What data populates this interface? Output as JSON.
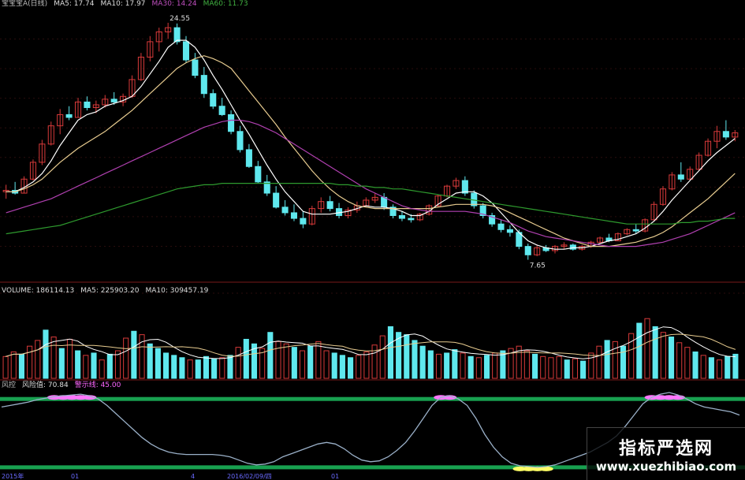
{
  "header": {
    "ma_line": [
      {
        "text": "宝宝宝A(日线)",
        "color": "#bbbbbb"
      },
      {
        "text": "MA5: 17.74",
        "color": "#dddddd"
      },
      {
        "text": "MA10: 17.97",
        "color": "#dddddd"
      },
      {
        "text": "MA30: 14.24",
        "color": "#c050c0"
      },
      {
        "text": "MA60: 11.73",
        "color": "#40b040"
      }
    ]
  },
  "colors": {
    "up": "#d83a3a",
    "down": "#5fe8ee",
    "ma5": "#ffffff",
    "ma10": "#e8cc90",
    "ma30": "#b040b0",
    "ma60": "#2e9a2e",
    "divider": "#7a1a1a",
    "risk": "#9ab0c8",
    "band": "#18a050",
    "high": "#ff77ff",
    "low": "#ffff66"
  },
  "chart_data": [
    {
      "type": "candlestick",
      "title": "宝宝宝A(日线)",
      "price_annotations": [
        {
          "label": "24.55",
          "value": 24.55
        },
        {
          "label": "7.65",
          "value": 7.65
        }
      ],
      "ylim": [
        6.5,
        25.5
      ],
      "ohlc": [
        [
          12.5,
          13.0,
          12.0,
          12.6
        ],
        [
          12.6,
          13.2,
          12.3,
          12.4
        ],
        [
          12.4,
          13.6,
          12.4,
          13.4
        ],
        [
          13.4,
          14.8,
          13.3,
          14.6
        ],
        [
          14.6,
          16.2,
          14.4,
          15.9
        ],
        [
          15.9,
          17.5,
          15.8,
          17.2
        ],
        [
          17.2,
          18.4,
          16.6,
          18.0
        ],
        [
          18.0,
          18.6,
          17.6,
          17.8
        ],
        [
          17.8,
          19.2,
          17.8,
          18.9
        ],
        [
          18.9,
          19.3,
          18.3,
          18.5
        ],
        [
          18.5,
          19.0,
          18.1,
          18.7
        ],
        [
          18.7,
          19.4,
          18.5,
          19.1
        ],
        [
          19.1,
          19.6,
          18.7,
          18.9
        ],
        [
          18.9,
          19.5,
          18.6,
          19.3
        ],
        [
          19.3,
          20.8,
          19.2,
          20.5
        ],
        [
          20.5,
          22.4,
          20.4,
          22.1
        ],
        [
          22.1,
          23.6,
          21.8,
          23.2
        ],
        [
          23.2,
          24.2,
          22.5,
          23.9
        ],
        [
          23.9,
          24.55,
          23.4,
          24.2
        ],
        [
          24.2,
          24.5,
          23.0,
          23.2
        ],
        [
          23.2,
          23.6,
          21.7,
          21.9
        ],
        [
          21.9,
          22.4,
          20.6,
          20.8
        ],
        [
          20.8,
          21.4,
          19.2,
          19.5
        ],
        [
          19.5,
          19.8,
          18.4,
          18.6
        ],
        [
          18.6,
          19.2,
          17.9,
          18.0
        ],
        [
          18.0,
          18.3,
          16.6,
          16.8
        ],
        [
          16.8,
          17.2,
          15.3,
          15.5
        ],
        [
          15.5,
          15.9,
          14.2,
          14.3
        ],
        [
          14.3,
          14.7,
          13.1,
          13.2
        ],
        [
          13.2,
          13.7,
          12.2,
          12.4
        ],
        [
          12.4,
          12.9,
          11.3,
          11.4
        ],
        [
          11.4,
          11.9,
          10.8,
          11.0
        ],
        [
          11.0,
          11.6,
          10.4,
          10.6
        ],
        [
          10.6,
          11.1,
          9.9,
          10.2
        ],
        [
          10.2,
          11.5,
          10.1,
          11.3
        ],
        [
          11.3,
          12.1,
          11.0,
          11.8
        ],
        [
          11.8,
          12.2,
          11.1,
          11.3
        ],
        [
          11.3,
          11.7,
          10.6,
          10.8
        ],
        [
          10.8,
          11.4,
          10.6,
          11.2
        ],
        [
          11.2,
          11.8,
          11.0,
          11.5
        ],
        [
          11.5,
          12.1,
          11.4,
          11.9
        ],
        [
          11.9,
          12.4,
          11.7,
          12.1
        ],
        [
          12.1,
          12.4,
          11.2,
          11.4
        ],
        [
          11.4,
          11.6,
          10.6,
          10.8
        ],
        [
          10.8,
          11.1,
          10.4,
          10.6
        ],
        [
          10.6,
          10.9,
          10.3,
          10.5
        ],
        [
          10.5,
          11.0,
          10.4,
          10.9
        ],
        [
          10.9,
          11.6,
          10.8,
          11.5
        ],
        [
          11.5,
          12.3,
          11.4,
          12.2
        ],
        [
          12.2,
          13.0,
          12.1,
          12.9
        ],
        [
          12.9,
          13.5,
          12.7,
          13.3
        ],
        [
          13.3,
          13.6,
          12.2,
          12.4
        ],
        [
          12.4,
          12.6,
          11.3,
          11.5
        ],
        [
          11.5,
          11.7,
          10.6,
          10.8
        ],
        [
          10.8,
          11.0,
          10.0,
          10.2
        ],
        [
          10.2,
          10.5,
          9.6,
          9.8
        ],
        [
          9.8,
          10.1,
          9.3,
          9.6
        ],
        [
          9.6,
          9.8,
          8.4,
          8.6
        ],
        [
          8.6,
          8.8,
          7.65,
          8.0
        ],
        [
          8.0,
          8.7,
          7.9,
          8.5
        ],
        [
          8.5,
          8.7,
          8.2,
          8.3
        ],
        [
          8.3,
          8.7,
          8.1,
          8.6
        ],
        [
          8.6,
          8.9,
          8.4,
          8.7
        ],
        [
          8.7,
          8.8,
          8.3,
          8.4
        ],
        [
          8.4,
          8.7,
          8.3,
          8.6
        ],
        [
          8.6,
          9.0,
          8.5,
          8.9
        ],
        [
          8.9,
          9.3,
          8.8,
          9.2
        ],
        [
          9.2,
          9.5,
          8.9,
          9.0
        ],
        [
          9.0,
          9.6,
          9.0,
          9.5
        ],
        [
          9.5,
          9.9,
          9.4,
          9.8
        ],
        [
          9.8,
          10.2,
          9.5,
          9.7
        ],
        [
          9.7,
          10.6,
          9.6,
          10.5
        ],
        [
          10.5,
          11.8,
          10.4,
          11.6
        ],
        [
          11.6,
          12.9,
          11.5,
          12.7
        ],
        [
          12.7,
          13.9,
          12.6,
          13.7
        ],
        [
          13.7,
          14.6,
          13.2,
          13.4
        ],
        [
          13.4,
          14.3,
          13.3,
          14.1
        ],
        [
          14.1,
          15.3,
          14.0,
          15.1
        ],
        [
          15.1,
          16.3,
          15.0,
          16.1
        ],
        [
          16.1,
          17.2,
          15.6,
          16.8
        ],
        [
          16.8,
          17.6,
          16.2,
          16.4
        ],
        [
          16.4,
          16.9,
          16.1,
          16.7
        ]
      ],
      "ma_series": [
        {
          "name": "MA5",
          "values": [
            12.5,
            12.5,
            12.8,
            13.2,
            13.8,
            14.7,
            15.8,
            16.7,
            17.6,
            18.0,
            18.2,
            18.6,
            18.8,
            19.0,
            19.3,
            20.0,
            20.9,
            21.8,
            22.8,
            23.3,
            23.3,
            22.8,
            21.9,
            20.8,
            19.8,
            18.7,
            17.6,
            16.6,
            15.5,
            14.4,
            13.4,
            12.5,
            11.8,
            11.1,
            10.9,
            10.9,
            10.9,
            11.0,
            11.1,
            11.3,
            11.5,
            11.4,
            11.4,
            11.3,
            11.1,
            10.8,
            10.8,
            11.1,
            11.6,
            12.0,
            12.4,
            12.5,
            12.5,
            12.2,
            11.7,
            11.0,
            10.3,
            9.6,
            9.0,
            8.7,
            8.5,
            8.4,
            8.4,
            8.5,
            8.5,
            8.6,
            8.8,
            9.0,
            9.1,
            9.3,
            9.5,
            9.9,
            10.4,
            11.1,
            11.9,
            12.6,
            13.3,
            14.0,
            14.7,
            15.3,
            15.8,
            16.3
          ],
          "color": "#ffffff"
        },
        {
          "name": "MA10",
          "values": [
            12.5,
            12.5,
            12.7,
            13.0,
            13.4,
            14.0,
            14.6,
            15.1,
            15.6,
            16.0,
            16.4,
            16.8,
            17.3,
            17.8,
            18.3,
            18.9,
            19.5,
            20.1,
            20.7,
            21.3,
            21.7,
            22.0,
            22.2,
            22.0,
            21.7,
            21.3,
            20.5,
            19.7,
            18.9,
            18.1,
            17.3,
            16.4,
            15.6,
            14.8,
            14.0,
            13.3,
            12.7,
            12.2,
            11.8,
            11.5,
            11.4,
            11.3,
            11.3,
            11.3,
            11.3,
            11.3,
            11.3,
            11.3,
            11.4,
            11.5,
            11.6,
            11.6,
            11.6,
            11.6,
            11.5,
            11.3,
            11.0,
            10.7,
            10.4,
            10.1,
            9.8,
            9.5,
            9.2,
            9.0,
            8.8,
            8.6,
            8.6,
            8.6,
            8.7,
            8.8,
            8.9,
            9.1,
            9.3,
            9.6,
            10.0,
            10.5,
            11.0,
            11.5,
            12.0,
            12.6,
            13.2,
            13.8
          ],
          "color": "#e8cc90"
        },
        {
          "name": "MA30",
          "values": [
            11.0,
            11.2,
            11.4,
            11.6,
            11.8,
            12.0,
            12.3,
            12.6,
            12.9,
            13.2,
            13.5,
            13.8,
            14.1,
            14.4,
            14.7,
            15.0,
            15.3,
            15.6,
            15.9,
            16.2,
            16.5,
            16.8,
            17.1,
            17.3,
            17.5,
            17.6,
            17.6,
            17.5,
            17.3,
            17.0,
            16.7,
            16.3,
            15.9,
            15.5,
            15.1,
            14.7,
            14.3,
            13.9,
            13.5,
            13.1,
            12.7,
            12.4,
            12.1,
            11.8,
            11.5,
            11.3,
            11.2,
            11.1,
            11.1,
            11.1,
            11.1,
            11.1,
            11.0,
            10.9,
            10.7,
            10.5,
            10.3,
            10.0,
            9.7,
            9.5,
            9.3,
            9.2,
            9.1,
            9.0,
            8.9,
            8.8,
            8.7,
            8.6,
            8.6,
            8.6,
            8.6,
            8.7,
            8.8,
            8.9,
            9.1,
            9.3,
            9.5,
            9.8,
            10.1,
            10.4,
            10.7,
            11.0
          ],
          "color": "#b040b0"
        },
        {
          "name": "MA60",
          "values": [
            9.5,
            9.6,
            9.7,
            9.8,
            9.9,
            10.0,
            10.1,
            10.3,
            10.5,
            10.7,
            10.9,
            11.1,
            11.3,
            11.5,
            11.7,
            11.9,
            12.1,
            12.3,
            12.5,
            12.7,
            12.8,
            12.9,
            13.0,
            13.0,
            13.1,
            13.1,
            13.1,
            13.1,
            13.1,
            13.1,
            13.1,
            13.1,
            13.1,
            13.1,
            13.1,
            13.1,
            13.1,
            13.0,
            13.0,
            12.9,
            12.9,
            12.8,
            12.8,
            12.7,
            12.7,
            12.6,
            12.5,
            12.4,
            12.3,
            12.2,
            12.1,
            12.0,
            11.9,
            11.8,
            11.7,
            11.6,
            11.5,
            11.4,
            11.3,
            11.2,
            11.1,
            11.0,
            10.9,
            10.8,
            10.7,
            10.6,
            10.5,
            10.4,
            10.3,
            10.2,
            10.2,
            10.2,
            10.2,
            10.2,
            10.2,
            10.3,
            10.3,
            10.4,
            10.4,
            10.5,
            10.6,
            10.6
          ],
          "color": "#2e9a2e"
        }
      ]
    },
    {
      "type": "bar",
      "title": "VOLUME: 186114.13  MA5: 225903.20  MA10: 309457.19",
      "header": [
        {
          "text": "VOLUME: 186114.13",
          "color": "#dddddd"
        },
        {
          "text": "MA5: 225903.20",
          "color": "#dddddd"
        },
        {
          "text": "MA10: 309457.19",
          "color": "#dddddd"
        }
      ],
      "ylim": [
        0,
        700000
      ],
      "values": [
        190000,
        230000,
        210000,
        280000,
        330000,
        420000,
        360000,
        260000,
        340000,
        240000,
        200000,
        220000,
        160000,
        210000,
        240000,
        350000,
        410000,
        380000,
        300000,
        260000,
        220000,
        200000,
        180000,
        160000,
        160000,
        190000,
        170000,
        180000,
        200000,
        270000,
        340000,
        300000,
        260000,
        400000,
        320000,
        300000,
        270000,
        240000,
        280000,
        320000,
        240000,
        220000,
        200000,
        180000,
        200000,
        230000,
        290000,
        370000,
        450000,
        400000,
        380000,
        330000,
        280000,
        240000,
        210000,
        220000,
        250000,
        220000,
        190000,
        180000,
        200000,
        220000,
        240000,
        260000,
        280000,
        240000,
        210000,
        190000,
        180000,
        190000,
        160000,
        170000,
        150000,
        220000,
        280000,
        330000,
        320000,
        280000,
        390000,
        480000,
        520000,
        450000,
        400000,
        360000,
        310000,
        270000,
        230000,
        200000,
        180000,
        160000,
        190000,
        210000
      ],
      "bar_dir": [
        1,
        1,
        -1,
        1,
        1,
        -1,
        1,
        -1,
        1,
        -1,
        1,
        -1,
        1,
        -1,
        1,
        1,
        -1,
        1,
        -1,
        -1,
        -1,
        -1,
        -1,
        1,
        -1,
        -1,
        -1,
        1,
        -1,
        1,
        -1,
        -1,
        1,
        -1,
        1,
        1,
        -1,
        1,
        -1,
        1,
        1,
        -1,
        -1,
        -1,
        1,
        1,
        1,
        1,
        -1,
        -1,
        -1,
        -1,
        -1,
        -1,
        1,
        -1,
        -1,
        1,
        -1,
        1,
        -1,
        1,
        -1,
        1,
        1,
        1,
        -1,
        1,
        1,
        1,
        -1,
        1,
        -1,
        1,
        1,
        -1,
        1,
        -1,
        1,
        -1,
        1,
        -1,
        1,
        -1,
        1,
        1,
        -1,
        1,
        -1,
        1,
        -1,
        -1
      ],
      "ma_series": [
        {
          "name": "MA5",
          "color": "#ffffff"
        },
        {
          "name": "MA10",
          "color": "#e8cc90"
        }
      ]
    },
    {
      "type": "line",
      "title": "风控",
      "header": [
        {
          "text": "风控",
          "color": "#bbbbbb"
        },
        {
          "text": "风险值: 70.84",
          "color": "#dddddd"
        },
        {
          "text": "警示线: 45.00",
          "color": "#ff66ff"
        }
      ],
      "ylim": [
        0,
        100
      ],
      "bands": [
        90,
        5
      ],
      "series": [
        {
          "name": "风险值",
          "values": [
            80,
            82,
            84,
            86,
            89,
            91,
            93,
            94,
            95,
            96,
            94,
            90,
            82,
            72,
            62,
            52,
            42,
            34,
            28,
            24,
            22,
            21,
            21,
            21,
            21,
            20,
            18,
            14,
            10,
            8,
            9,
            12,
            18,
            22,
            26,
            30,
            34,
            36,
            34,
            28,
            20,
            14,
            12,
            13,
            18,
            26,
            36,
            50,
            66,
            82,
            92,
            94,
            90,
            82,
            66,
            46,
            30,
            18,
            10,
            7,
            6,
            5,
            6,
            8,
            12,
            16,
            20,
            24,
            30,
            36,
            44,
            56,
            70,
            84,
            92,
            96,
            98,
            95,
            90,
            84,
            80,
            78,
            76,
            74,
            70
          ]
        }
      ]
    }
  ],
  "axis_labels": [
    "2015年",
    "01",
    "4",
    "2016/02/09/四",
    "01"
  ],
  "watermark": {
    "line1": "指标严选网",
    "line2": "www.xuezhibiao.com"
  }
}
